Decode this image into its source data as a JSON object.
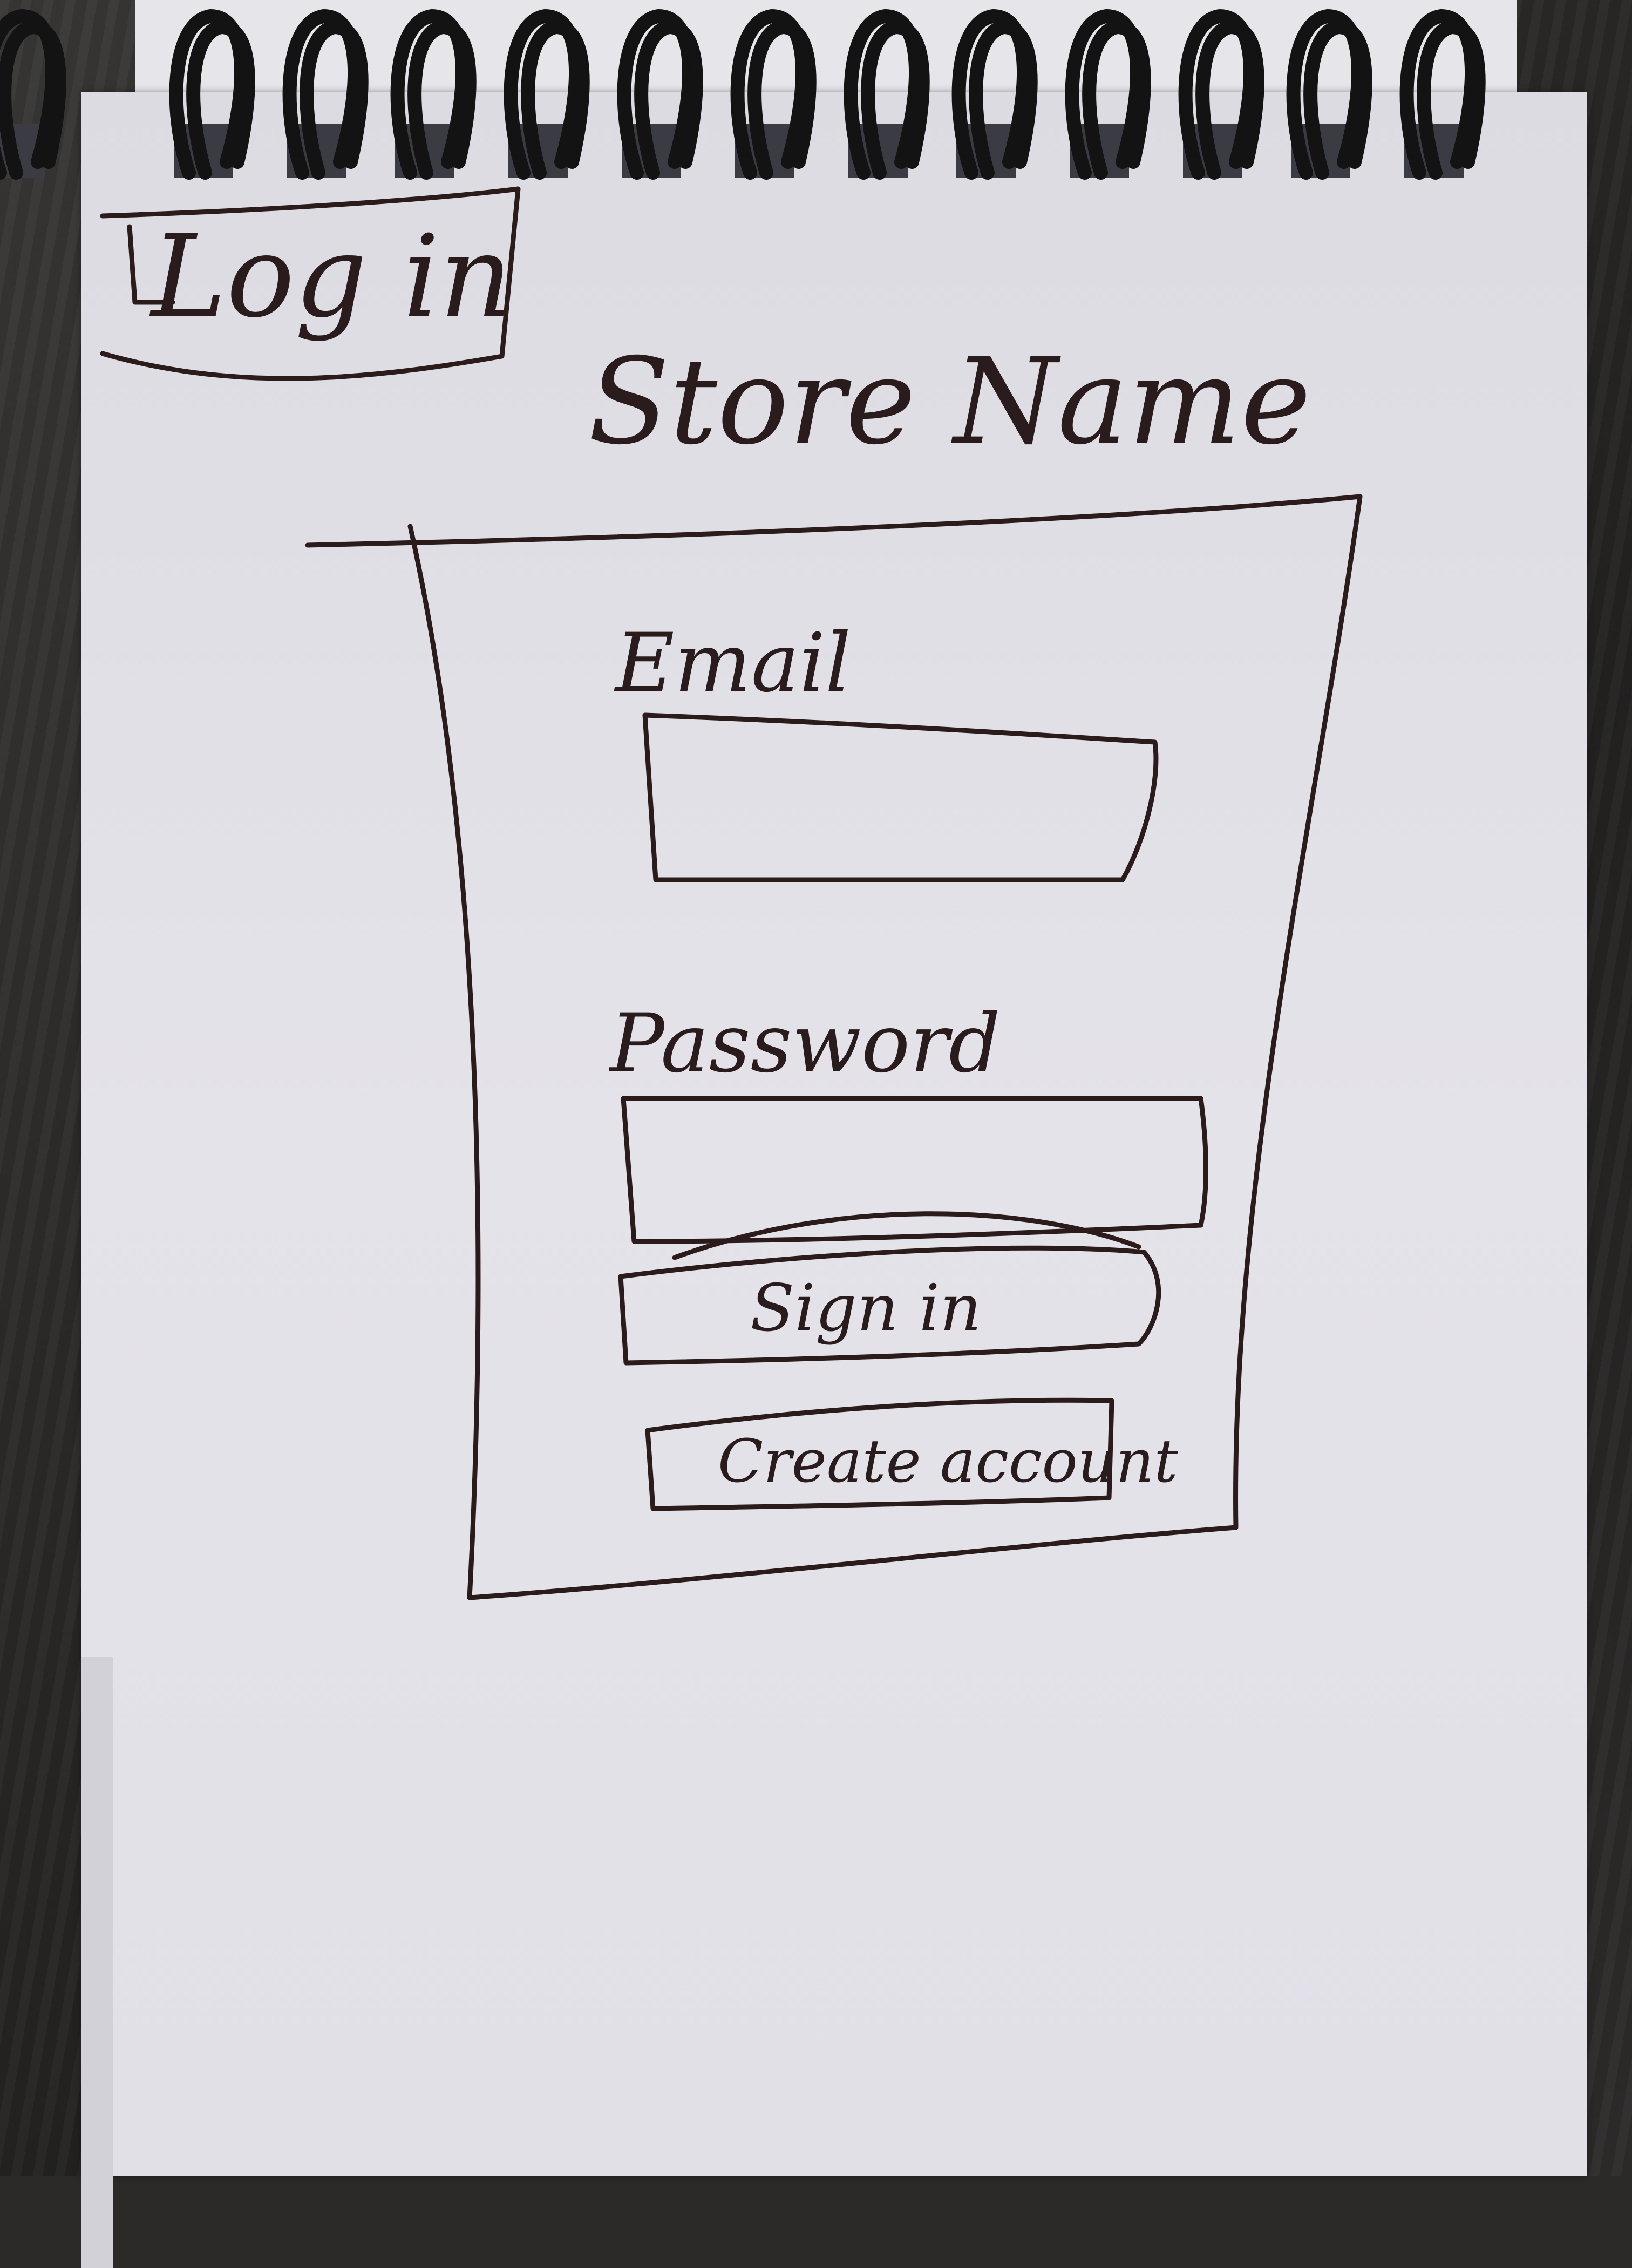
{
  "header": {
    "login_label": "Log in",
    "store_name": "Store Name"
  },
  "form": {
    "email_label": "Email",
    "email_value": "",
    "password_label": "Password",
    "password_value": "",
    "sign_in_label": "Sign in",
    "create_account_label": "Create account"
  },
  "colors": {
    "ink": "#2b1b1b",
    "paper": "#e2e1e8",
    "spiral": "#141414"
  }
}
